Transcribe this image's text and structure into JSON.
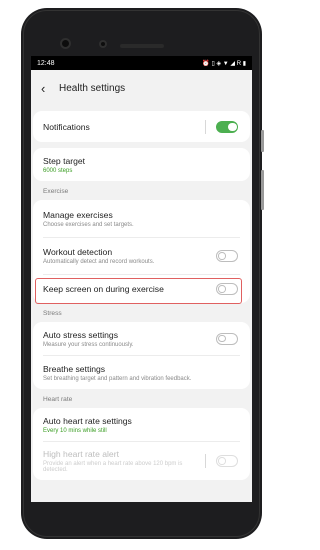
{
  "statusbar": {
    "time": "12:48",
    "icons": "⏰ ▯ ◈ ▼ ◢ R ▮"
  },
  "header": {
    "back_glyph": "‹",
    "title": "Health settings"
  },
  "notifications": {
    "label": "Notifications",
    "enabled": true
  },
  "step_target": {
    "label": "Step target",
    "value": "6000 steps"
  },
  "exercise": {
    "section_label": "Exercise",
    "manage": {
      "label": "Manage exercises",
      "sub": "Choose exercises and set targets."
    },
    "workout": {
      "label": "Workout detection",
      "sub": "Automatically detect and record workouts.",
      "enabled": false
    },
    "keep_screen": {
      "label": "Keep screen on during exercise",
      "enabled": false
    }
  },
  "stress": {
    "section_label": "Stress",
    "auto": {
      "label": "Auto stress settings",
      "sub": "Measure your stress continuously.",
      "enabled": false
    },
    "breathe": {
      "label": "Breathe settings",
      "sub": "Set breathing target and pattern and vibration feedback."
    }
  },
  "heart_rate": {
    "section_label": "Heart rate",
    "auto": {
      "label": "Auto heart rate settings",
      "sub": "Every 10 mins while still"
    },
    "high_alert": {
      "label": "High heart rate alert",
      "sub": "Provide an alert when a heart rate above 120 bpm is detected.",
      "enabled": false
    }
  },
  "colors": {
    "accent_green": "#4caf50",
    "highlight_red": "#e06060"
  }
}
